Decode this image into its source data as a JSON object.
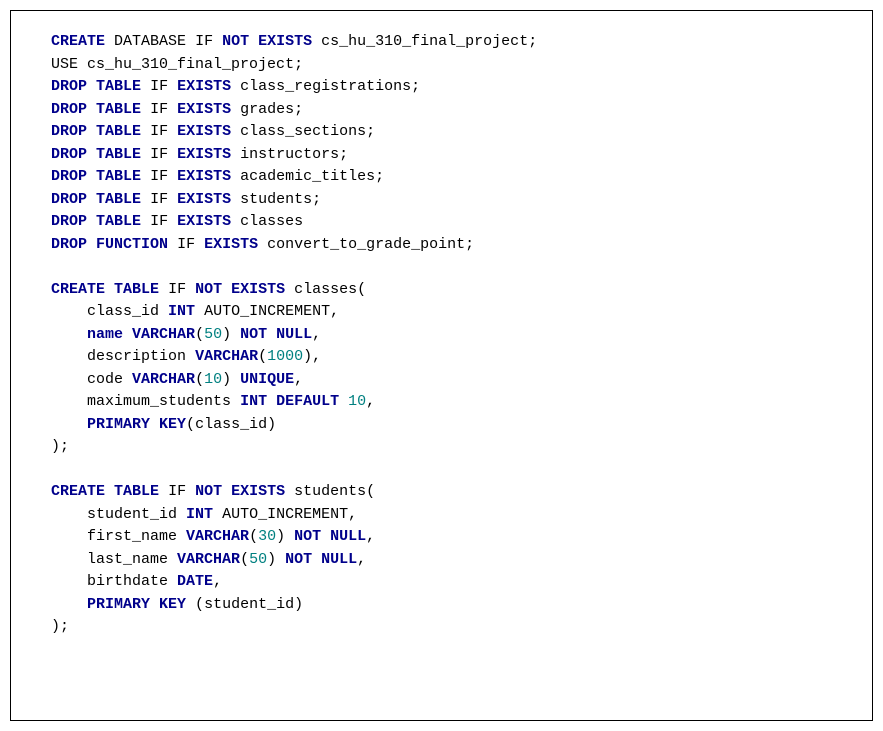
{
  "sql": {
    "db_name": "cs_hu_310_final_project",
    "use_db": "cs_hu_310_final_project",
    "drop_tables": [
      "class_registrations",
      "grades",
      "class_sections",
      "instructors",
      "academic_titles",
      "students",
      "classes"
    ],
    "drop_function": "convert_to_grade_point",
    "kw": {
      "CREATE": "CREATE",
      "DATABASE": "DATABASE",
      "IF": "IF",
      "NOT": "NOT",
      "EXISTS": "EXISTS",
      "USE": "USE",
      "DROP": "DROP",
      "TABLE": "TABLE",
      "FUNCTION": "FUNCTION",
      "INT": "INT",
      "VARCHAR": "VARCHAR",
      "NOT_NULL": "NOT NULL",
      "UNIQUE": "UNIQUE",
      "DEFAULT": "DEFAULT",
      "DATE": "DATE",
      "PRIMARY_KEY": "PRIMARY KEY"
    },
    "tables": {
      "classes": {
        "name": "classes",
        "cols": {
          "class_id": "class_id",
          "name": "name",
          "description": "description",
          "code": "code",
          "maximum_students": "maximum_students"
        },
        "auto_increment": "AUTO_INCREMENT",
        "varchar50": "50",
        "varchar1000": "1000",
        "varchar10": "10",
        "default10": "10",
        "pk": "class_id"
      },
      "students": {
        "name": "students",
        "cols": {
          "student_id": "student_id",
          "first_name": "first_name",
          "last_name": "last_name",
          "birthdate": "birthdate"
        },
        "auto_increment": "AUTO_INCREMENT",
        "varchar30": "30",
        "varchar50": "50",
        "pk": "student_id"
      }
    }
  }
}
